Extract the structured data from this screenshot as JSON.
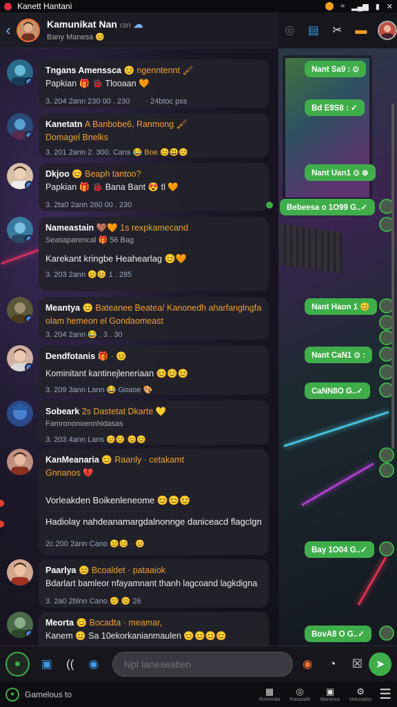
{
  "status_bar": {
    "title": "Kanett Hantani",
    "icons": [
      "notification-icon",
      "wifi-icon",
      "signal-icon",
      "battery-icon"
    ]
  },
  "header": {
    "name": "Kamunikat Nan",
    "name_suffix": "ran",
    "subtitle": "Bany Manesa 😊",
    "icons": [
      "back-icon",
      "keyboard-icon",
      "moon-icon",
      "list-icon",
      "tools-icon",
      "briefcase-icon"
    ]
  },
  "messages": [
    {
      "line1": "Tngans Amenssca",
      "line1_accent": "😊 ngenntennt 🖌",
      "line2": "Papkian 🎁 🐞 Tlooaan 🧡",
      "line2_style": "",
      "body": "",
      "meta": "3. 204 2ann  230 00 . 230",
      "meta_extra": "· 24btoc pss"
    },
    {
      "line1": "Kanetatn",
      "line1_accent": "A Banbobe6, Ranmong 🖌",
      "line2": "Domagel Bnelks",
      "line2_style": "orange",
      "body": "",
      "meta": "3. 201 2ann 2. 300. Cans",
      "meta_extra": "😂 Boe 😊😃😊"
    },
    {
      "line1": "Dkjoo",
      "line1_accent": "😊 Beaph tantoo?",
      "line2": "Papkian 🎁 🐞 Bana Bant 😍 tl 🧡",
      "line2_style": "",
      "body": "",
      "meta": "3. 2ta0 2ann  260 00 . 230",
      "meta_extra": ""
    },
    {
      "line1": "Nameastain",
      "line1_accent": "🤎🧡 1s rexpkamecand",
      "line2": "Seasaparencal 🎁 56 Bag",
      "line2_style": "",
      "body": "Karekant kringbe Heahearlag 😊🧡",
      "meta": "3. 203  2ann  😊😊 1 . 285",
      "meta_extra": ""
    },
    {
      "line1": "Meantya",
      "line1_accent": "😊 Bateanee Beatea/ Kanonedh aharfanglngfant",
      "line2": "olam  hemeon  el Gondaomeast",
      "line2_style": "orange",
      "body": "",
      "meta": "3. 204  2ann  😂 . 3 . 30",
      "meta_extra": ""
    },
    {
      "line1": "Dendfotanis",
      "line1_accent": "🎁 · 😊",
      "line2": "Kominitant kantinejleneriaan 😊😊😊",
      "line2_style": "",
      "body": "",
      "meta": "3. 209  3ann  Lann  😂 Goaoe 🎨",
      "meta_extra": ""
    },
    {
      "line1": "Sobeark",
      "line1_accent": "2s  Dastetat Dkarte 💛",
      "line2": "Famrononoennhidasas",
      "line2_style": "",
      "body": "",
      "meta": "3. 203  4ann  Lans  😊😊 😊😊",
      "meta_extra": ""
    },
    {
      "line1": "KanMeanaria",
      "line1_accent": "😊 Raanly · cetakamt",
      "line2": "Gnnanos 💔",
      "line2_style": "orange",
      "body": "Vorleakden Boikenleneome  😊😊😊",
      "body2": "Hadiolay nahdeanamargdalnonnge daniceacd flagclgnt",
      "meta": "2c 200  2ann  Cano  😊😊 · 😊",
      "meta_extra": ""
    },
    {
      "line1": "Paarlya",
      "line1_accent": "😊 Bcoaldet · pataaiok",
      "line2": "Bdarlart bamleor nfayamnant thanh lagcoand lagkdigna",
      "line2_style": "",
      "body": "",
      "meta": "3. 2a0  2blnn  Cano  😊 😊 26",
      "meta_extra": ""
    },
    {
      "line1": "Meorta",
      "line1_accent": "😊 Bocadta · meamar,",
      "line2": "Kanem 😊 Sa 10ekorkanianmaulen 😊😊😊😊",
      "line2_style": "",
      "body": "",
      "meta": "",
      "meta_extra": ""
    }
  ],
  "right_bubbles": [
    {
      "text": "Nant Sa9 : ⊙"
    },
    {
      "text": "Bd E9S8 : ✓"
    },
    {
      "text": "Nant Uan1 ⊙ ⊗"
    },
    {
      "text": "Bebeesa o 1O99 G..✓"
    },
    {
      "text": "Nant Haon 1 😊"
    },
    {
      "text": "Nant CaN1 ⊙ :"
    },
    {
      "text": "CaNN8O G..✓"
    },
    {
      "text": "Bay 1O04 G..✓"
    },
    {
      "text": "BovA8 O G..✓"
    }
  ],
  "composer": {
    "placeholder": "Npl Ianeseatien",
    "tools": [
      "folder-icon",
      "paren-icon",
      "circle-icon"
    ],
    "after_icons": [
      "emoji-icon",
      "timer-icon",
      "close-box-icon"
    ]
  },
  "bottom_nav": {
    "gallery_label": "Gamelous  to",
    "items": [
      {
        "label": "Romenda",
        "icon": "▦"
      },
      {
        "label": "Rianpadtt",
        "icon": "◎"
      },
      {
        "label": "Blaneora",
        "icon": "▣"
      },
      {
        "label": "Manceplot",
        "icon": "⚙"
      }
    ]
  },
  "colors": {
    "accent_green": "#3fae4a",
    "accent_orange": "#f0a030",
    "link_blue": "#7fb0ff"
  }
}
